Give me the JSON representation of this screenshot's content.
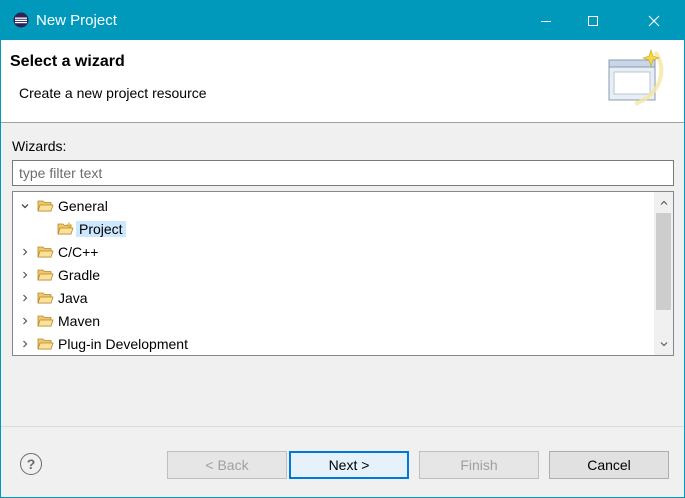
{
  "window": {
    "title": "New Project"
  },
  "header": {
    "title": "Select a wizard",
    "description": "Create a new project resource"
  },
  "wizards": {
    "label": "Wizards:",
    "filter_placeholder": "type filter text",
    "filter_value": ""
  },
  "tree": {
    "items": [
      {
        "label": "General",
        "expanded": true
      },
      {
        "label": "Project",
        "selected": true
      },
      {
        "label": "C/C++",
        "expanded": false
      },
      {
        "label": "Gradle",
        "expanded": false
      },
      {
        "label": "Java",
        "expanded": false
      },
      {
        "label": "Maven",
        "expanded": false
      },
      {
        "label": "Plug-in Development",
        "expanded": false
      }
    ]
  },
  "buttons": {
    "back": "< Back",
    "next": "Next >",
    "finish": "Finish",
    "cancel": "Cancel"
  },
  "colors": {
    "titlebar": "#0099bc",
    "selection": "#cce8ff",
    "default_button_border": "#0078d7"
  }
}
